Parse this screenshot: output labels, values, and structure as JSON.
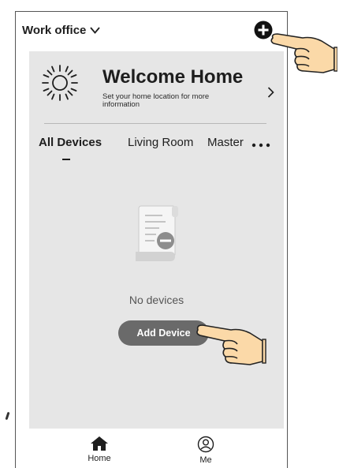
{
  "header": {
    "home_name": "Work office",
    "home_selector_icon": "chevron-down-icon",
    "add_icon": "plus-circle-icon"
  },
  "welcome": {
    "icon": "sun-icon",
    "title": "Welcome Home",
    "subtitle": "Set your home location for more information",
    "arrow_icon": "chevron-right-icon"
  },
  "tabs": {
    "items": [
      {
        "label": "All Devices",
        "active": true
      },
      {
        "label": "Living Room",
        "active": false
      },
      {
        "label": "Master",
        "active": false
      }
    ],
    "more_icon": "more-dots-icon"
  },
  "empty_state": {
    "icon": "document-remove-icon",
    "message": "No devices",
    "button_label": "Add Device"
  },
  "bottom_nav": {
    "items": [
      {
        "label": "Home",
        "icon": "home-icon"
      },
      {
        "label": "Me",
        "icon": "user-icon"
      }
    ]
  },
  "colors": {
    "panel_bg": "#e6e6e6",
    "button_bg": "#6a6a6a",
    "hand_skin": "#fbd9a8",
    "text": "#1e1e1e"
  }
}
